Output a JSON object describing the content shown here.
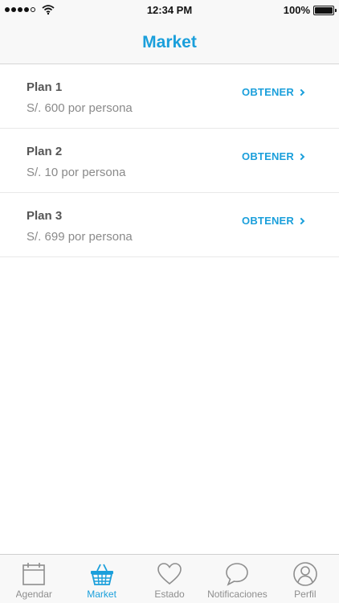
{
  "status_bar": {
    "time": "12:34 PM",
    "battery": "100%"
  },
  "nav": {
    "title": "Market"
  },
  "plans": [
    {
      "name": "Plan 1",
      "price": "S/. 600 por persona",
      "action": "OBTENER"
    },
    {
      "name": "Plan 2",
      "price": "S/. 10 por persona",
      "action": "OBTENER"
    },
    {
      "name": "Plan 3",
      "price": "S/. 699 por persona",
      "action": "OBTENER"
    }
  ],
  "tabs": [
    {
      "label": "Agendar",
      "icon": "calendar-icon"
    },
    {
      "label": "Market",
      "icon": "basket-icon"
    },
    {
      "label": "Estado",
      "icon": "heart-icon"
    },
    {
      "label": "Notificaciones",
      "icon": "chat-bubble-icon"
    },
    {
      "label": "Perfil",
      "icon": "user-icon"
    }
  ],
  "colors": {
    "accent": "#1a9fdb",
    "inactive_tab": "#8e8e8e"
  }
}
